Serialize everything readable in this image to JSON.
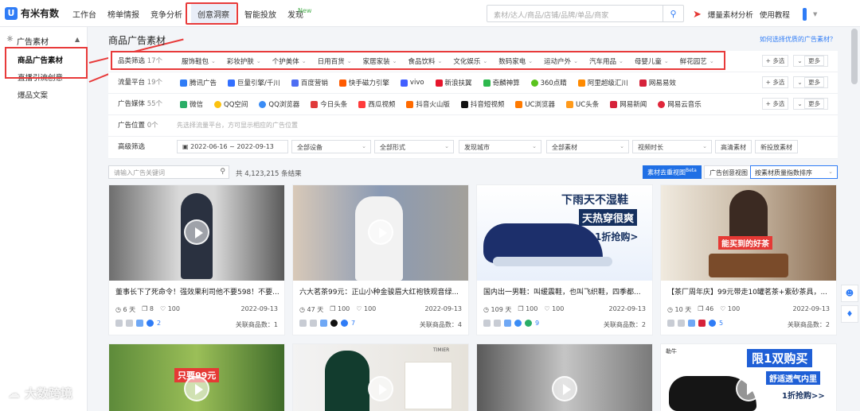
{
  "app": {
    "brand": "有米有数"
  },
  "nav": {
    "items": [
      "工作台",
      "榜单情报",
      "竞争分析",
      "创意洞察",
      "智能投放",
      "发现"
    ],
    "new_tag": "New",
    "search_placeholder": "素材/达人/商品/店铺/品牌/单品/商家",
    "hot_analysis": "爆量素材分析",
    "tutorial": "使用教程"
  },
  "sidebar": {
    "section": "广告素材",
    "items": [
      "商品广告素材",
      "直播引流创意",
      "爆品文案"
    ]
  },
  "main": {
    "title": "商品广告素材",
    "help_link": "如何选择优质的广告素材？",
    "multi": "+ 多选",
    "more": "更多",
    "category": {
      "label": "品类筛选",
      "count": "17个",
      "items": [
        "服饰鞋包",
        "彩妆护肤",
        "个护美体",
        "日用百货",
        "家居家装",
        "食品饮料",
        "文化娱乐",
        "数码家电",
        "运动户外",
        "汽车用品",
        "母婴儿童",
        "鲜花园艺"
      ]
    },
    "platform": {
      "label": "流量平台",
      "count": "19个",
      "items": [
        "腾讯广告",
        "巨量引擎/千川",
        "百度营销",
        "快手磁力引擎",
        "vivo",
        "新浪扶翼",
        "奇麟神算",
        "360点睛",
        "阿里超级汇川",
        "网易易效"
      ]
    },
    "media": {
      "label": "广告媒体",
      "count": "55个",
      "items": [
        "微信",
        "QQ空间",
        "QQ浏览器",
        "今日头条",
        "西瓜视频",
        "抖音火山版",
        "抖音短视频",
        "UC浏览器",
        "UC头条",
        "网易新闻",
        "网易云音乐"
      ]
    },
    "position": {
      "label": "广告位置",
      "count": "0个",
      "hint": "先选择流量平台，方可显示相应的广告位置"
    },
    "advanced": {
      "label": "高级筛选",
      "date": "2022-06-16 ~ 2022-09-13",
      "selects": [
        "全部设备",
        "全部形式",
        "发现城市",
        "全部素材",
        "视频时长"
      ],
      "checks": [
        "高清素材",
        "新投放素材"
      ]
    },
    "keyword_placeholder": "请输入广告关键词",
    "total": "共 4,123,215 条结果",
    "view_primary": "素材去重视图",
    "beta": "Beta",
    "view_plain": "广告创意视图",
    "sort": "按素材质量指数排序"
  },
  "cards": [
    {
      "title": "董事长下了死命令！强效果利司他不要598！不要...",
      "days": "6 天",
      "count": "8",
      "likes": "100",
      "date": "2022-09-13",
      "more": "2",
      "linked": "关联商品数：1"
    },
    {
      "title": "六大茗茶99元：正山小种金骏眉大红袍铁观音绿...",
      "days": "47 天",
      "count": "100",
      "likes": "100",
      "date": "2022-09-13",
      "more": "7",
      "linked": "关联商品数：4"
    },
    {
      "title": "国内出一男鞋：叫缓震鞋，也叫飞织鞋，四季都...",
      "days": "109 天",
      "count": "100",
      "likes": "100",
      "date": "2022-09-13",
      "more": "9",
      "linked": "关联商品数：2"
    },
    {
      "title": "【茶厂周年庆】99元带走10罐茗茶+紫砂茶具，...",
      "days": "10 天",
      "count": "46",
      "likes": "100",
      "date": "2022-09-13",
      "more": "5",
      "linked": "关联商品数：2"
    }
  ],
  "promo": {
    "shoe_top": "下雨天不湿鞋",
    "shoe_mid": "天热穿很爽",
    "shoe_btm": "1折抢购>",
    "tea": "能买到的好茶",
    "limit_top": "限1双购买",
    "limit_mid": "舒适透气内里",
    "limit_btm": "1折抢购>>",
    "price": "只要99元",
    "brand_small": "TIMIER",
    "brand_shoe": "勒牛"
  },
  "watermark": "大数跨境",
  "colors": {
    "accent": "#2f7cf6",
    "highlight": "#e83a3a"
  }
}
